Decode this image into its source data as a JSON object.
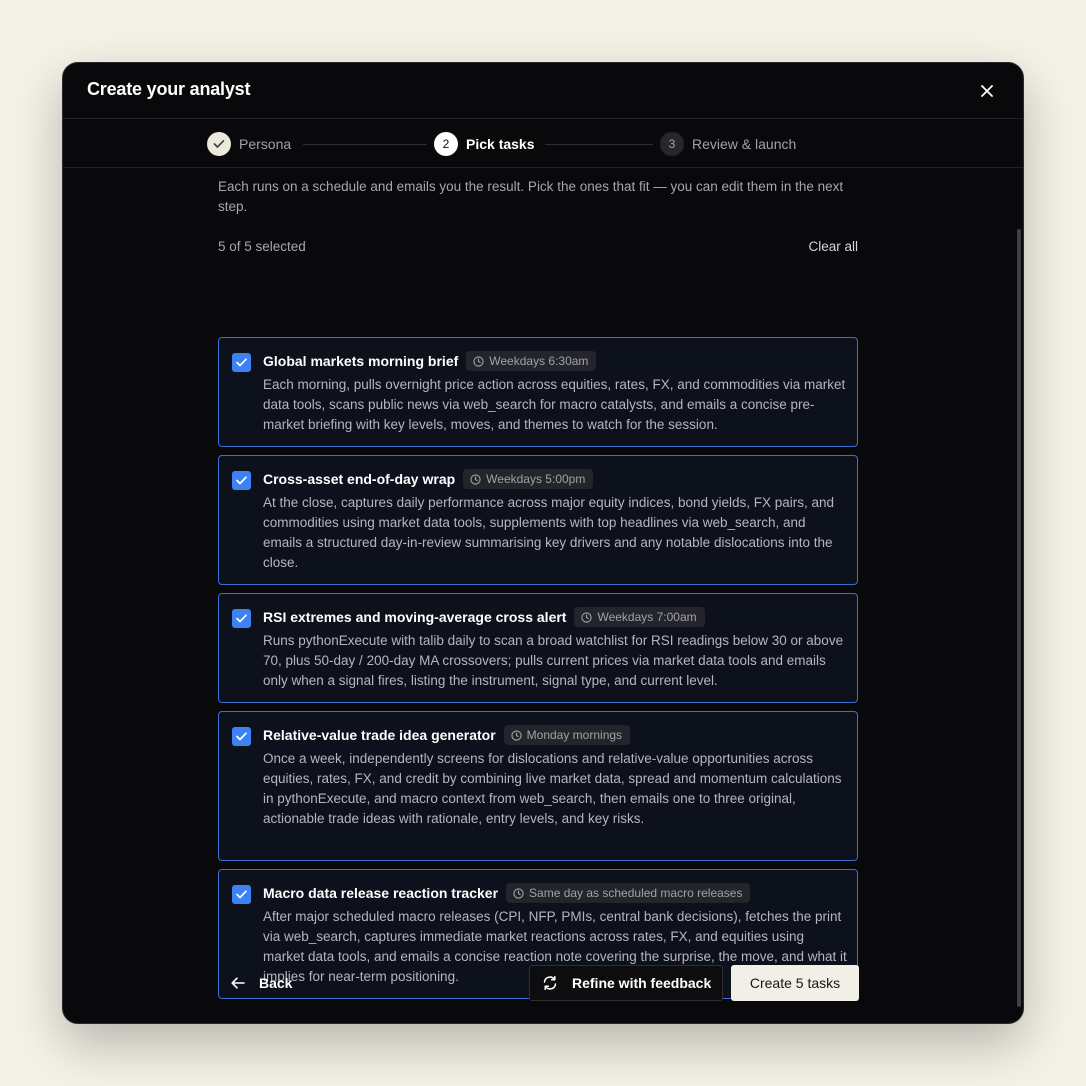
{
  "modal": {
    "title": "Create your analyst"
  },
  "steps": [
    {
      "number": "✓",
      "label": "Persona",
      "state": "done"
    },
    {
      "number": "2",
      "label": "Pick tasks",
      "state": "active"
    },
    {
      "number": "3",
      "label": "Review & launch",
      "state": "upcoming"
    }
  ],
  "intro": "Each runs on a schedule and emails you the result. Pick the ones that fit — you can edit them in the next step.",
  "selection": {
    "count_text": "5 of 5 selected",
    "clear_label": "Clear all"
  },
  "tasks": [
    {
      "title": "Global markets morning brief",
      "schedule": "Weekdays 6:30am",
      "checked": true,
      "description": "Each morning, pulls overnight price action across equities, rates, FX, and commodities via market data tools, scans public news via web_search for macro catalysts, and emails a concise pre-market briefing with key levels, moves, and themes to watch for the session."
    },
    {
      "title": "Cross-asset end-of-day wrap",
      "schedule": "Weekdays 5:00pm",
      "checked": true,
      "description": "At the close, captures daily performance across major equity indices, bond yields, FX pairs, and commodities using market data tools, supplements with top headlines via web_search, and emails a structured day-in-review summarising key drivers and any notable dislocations into the close."
    },
    {
      "title": "RSI extremes and moving-average cross alert",
      "schedule": "Weekdays 7:00am",
      "checked": true,
      "description": "Runs pythonExecute with talib daily to scan a broad watchlist for RSI readings below 30 or above 70, plus 50-day / 200-day MA crossovers; pulls current prices via market data tools and emails only when a signal fires, listing the instrument, signal type, and current level."
    },
    {
      "title": "Relative-value trade idea generator",
      "schedule": "Monday mornings",
      "checked": true,
      "description": "Once a week, independently screens for dislocations and relative-value opportunities across equities, rates, FX, and credit by combining live market data, spread and momentum calculations in pythonExecute, and macro context from web_search, then emails one to three original, actionable trade ideas with rationale, entry levels, and key risks."
    },
    {
      "title": "Macro data release reaction tracker",
      "schedule": "Same day as scheduled macro releases",
      "checked": true,
      "description": "After major scheduled macro releases (CPI, NFP, PMIs, central bank decisions), fetches the print via web_search, captures immediate market reactions across rates, FX, and equities using market data tools, and emails a concise reaction note covering the surprise, the move, and what it implies for near-term positioning."
    }
  ],
  "footer": {
    "back_label": "Back",
    "refine_label": "Refine with feedback",
    "create_label": "Create 5 tasks"
  },
  "colors": {
    "accent": "#3d82f2",
    "card_border": "#3b6fd6",
    "modal_bg": "#09090b",
    "page_bg": "#f4f1e6",
    "primary_button": "#f2efe6"
  }
}
